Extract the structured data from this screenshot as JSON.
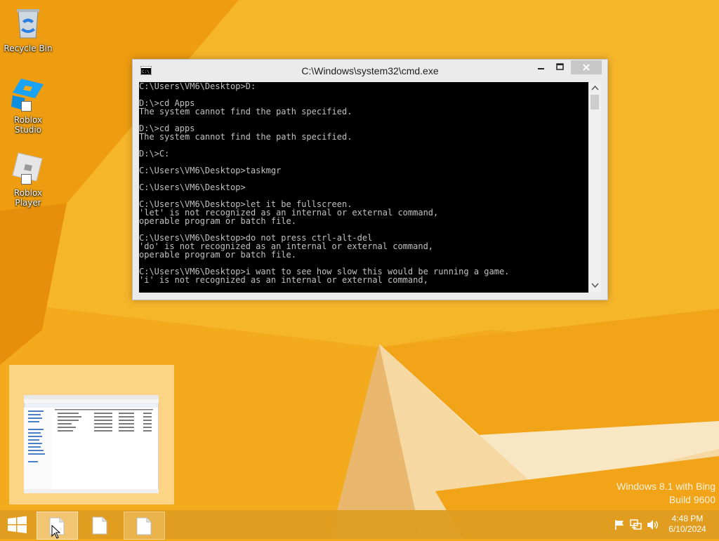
{
  "desktop": {
    "icons": [
      {
        "label": "Recycle Bin"
      },
      {
        "label": "Roblox Studio"
      },
      {
        "label": "Roblox Player"
      }
    ],
    "watermark": {
      "line1": "Windows 8.1 with Bing",
      "line2": "Build 9600"
    },
    "colors": {
      "wallpaper_base": "#f2a91a",
      "wallpaper_light": "#f7c63b",
      "taskbar": "#de9c20"
    }
  },
  "cmd_window": {
    "title": "C:\\Windows\\system32\\cmd.exe",
    "lines": [
      "C:\\Users\\VM6\\Desktop>D:",
      "",
      "D:\\>cd Apps",
      "The system cannot find the path specified.",
      "",
      "D:\\>cd apps",
      "The system cannot find the path specified.",
      "",
      "D:\\>C:",
      "",
      "C:\\Users\\VM6\\Desktop>taskmgr",
      "",
      "C:\\Users\\VM6\\Desktop>",
      "",
      "C:\\Users\\VM6\\Desktop>let it be fullscreen.",
      "'let' is not recognized as an internal or external command,",
      "operable program or batch file.",
      "",
      "C:\\Users\\VM6\\Desktop>do not press ctrl-alt-del",
      "'do' is not recognized as an internal or external command,",
      "operable program or batch file.",
      "",
      "C:\\Users\\VM6\\Desktop>i want to see how slow this would be running a game.",
      "'i' is not recognized as an internal or external command,"
    ],
    "colors": {
      "console_bg": "#000000",
      "console_fg": "#c0c0c0"
    }
  },
  "taskbar": {
    "icons": [
      "start-icon",
      "document-icon",
      "document-icon",
      "document-icon"
    ],
    "tray_icons": [
      "flag-icon",
      "network-icon",
      "speaker-icon"
    ],
    "clock": {
      "time": "4:48 PM",
      "date": "6/10/2024"
    }
  }
}
